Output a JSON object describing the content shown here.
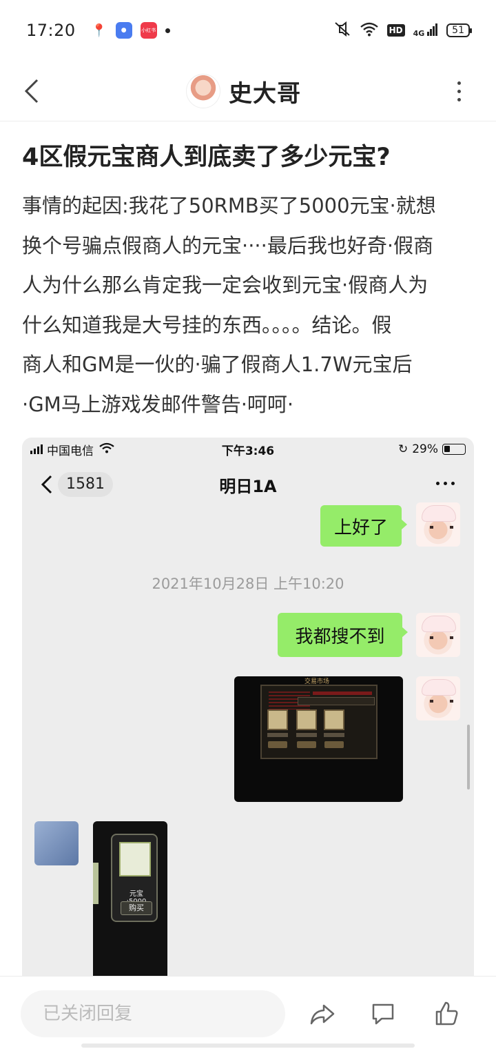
{
  "status_bar": {
    "time": "17:20",
    "notif_red_app": "小红书",
    "hd": "HD",
    "network": "4G",
    "battery": "51"
  },
  "header": {
    "title": "史大哥"
  },
  "post": {
    "title": "4区假元宝商人到底卖了多少元宝?",
    "body_lines": [
      "事情的起因:我花了50RMB买了5000元宝·就想",
      "换个号骗点假商人的元宝····最后我也好奇·假商",
      "人为什么那么肯定我一定会收到元宝·假商人为",
      "什么知道我是大号挂的东西。。。。结论。假",
      "商人和GM是一伙的·骗了假商人1.7W元宝后",
      "·GM马上游戏发邮件警告·呵呵·"
    ]
  },
  "screenshot": {
    "carrier": "中国电信",
    "time": "下午3:46",
    "battery": "29%",
    "back_badge": "1581",
    "chat_title": "明日1A",
    "messages": [
      {
        "text": "上好了"
      },
      {
        "text": "我都搜不到"
      }
    ],
    "timestamp": "2021年10月28日 上午10:20",
    "game1_header": "交易市场",
    "game2_price": "元宝 :5000",
    "game2_button": "购买"
  },
  "bottom_bar": {
    "reply_placeholder": "已关闭回复"
  },
  "icons": {
    "back": "chevron-left-icon",
    "more": "more-vertical-icon",
    "share": "share-icon",
    "comment": "comment-icon",
    "like": "thumbs-up-icon"
  }
}
